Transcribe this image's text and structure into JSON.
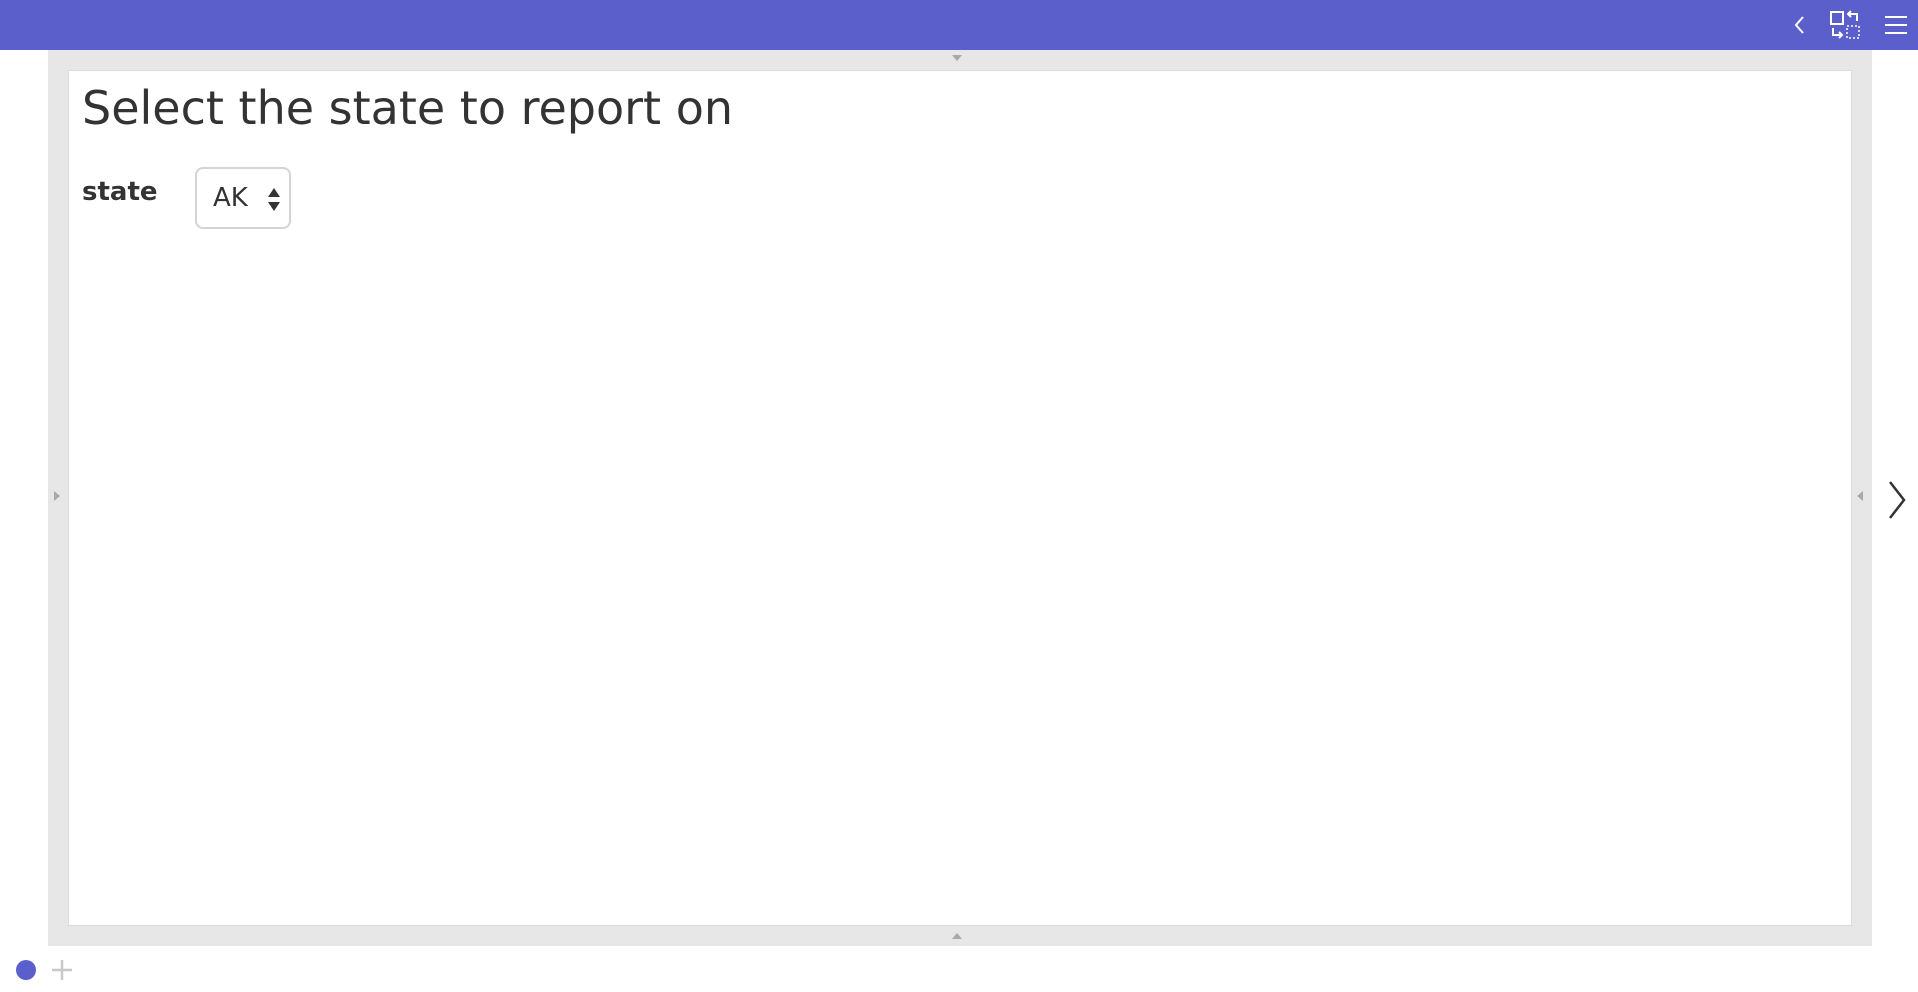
{
  "header": {
    "background_color": "#5b5fcb",
    "icons": [
      "chevron-left-icon",
      "swap-layout-icon",
      "hamburger-menu-icon"
    ]
  },
  "card": {
    "title": "Select the state to report on",
    "field": {
      "label": "state",
      "selected_value": "AK"
    }
  },
  "nav": {
    "next_icon": "chevron-right-icon"
  },
  "footer": {
    "page_dot_color": "#5b5fcb",
    "add_icon": "plus-icon"
  }
}
